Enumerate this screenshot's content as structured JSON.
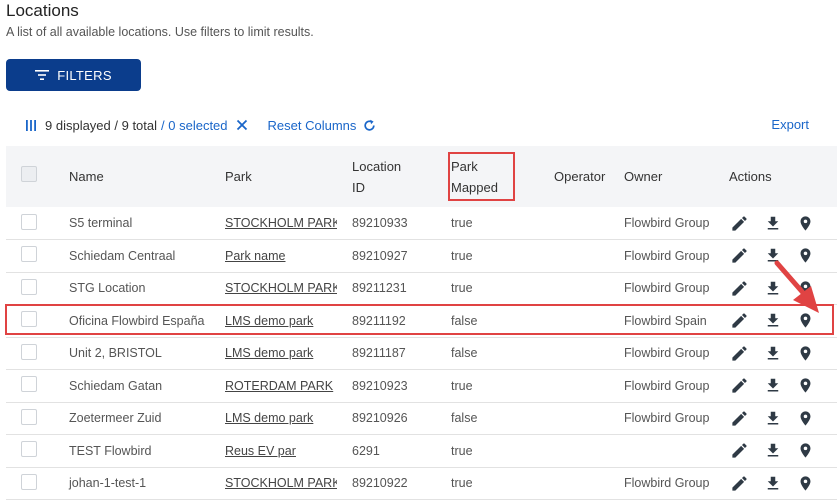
{
  "page": {
    "title": "Locations",
    "subtitle": "A list of all available locations. Use filters to limit results."
  },
  "filters_button": {
    "label": "FILTERS",
    "icon": "filter-icon"
  },
  "toolbar": {
    "columns_icon": "columns-icon",
    "displayed": "9 displayed / 9 total",
    "selected": "/ 0 selected",
    "clear_icon": "close-icon",
    "reset_columns": "Reset Columns",
    "reset_icon": "refresh-icon",
    "export": "Export"
  },
  "columns": {
    "name": "Name",
    "park": "Park",
    "location_id_1": "Location",
    "location_id_2": "ID",
    "park_mapped_1": "Park",
    "park_mapped_2": "Mapped",
    "operator": "Operator",
    "owner": "Owner",
    "actions": "Actions"
  },
  "rows": [
    {
      "name": "S5 terminal",
      "park": "STOCKHOLM PARK",
      "location_id": "89210933",
      "park_mapped": "true",
      "operator": "",
      "owner": "Flowbird Group",
      "icons": [
        "pencil-icon",
        "download-icon",
        "map-pin-icon"
      ]
    },
    {
      "name": "Schiedam Centraal",
      "park": "Park name",
      "location_id": "89210927",
      "park_mapped": "true",
      "operator": "",
      "owner": "Flowbird Group",
      "icons": [
        "pencil-icon",
        "download-icon",
        "map-pin-icon"
      ]
    },
    {
      "name": "STG Location",
      "park": "STOCKHOLM PARK",
      "location_id": "89211231",
      "park_mapped": "true",
      "operator": "",
      "owner": "Flowbird Group",
      "icons": [
        "pencil-icon",
        "download-icon",
        "map-pin-icon"
      ]
    },
    {
      "name": "Oficina Flowbird España",
      "park": "LMS demo park",
      "location_id": "89211192",
      "park_mapped": "false",
      "operator": "",
      "owner": "Flowbird Spain",
      "icons": [
        "pencil-icon",
        "download-icon",
        "map-pin-icon"
      ]
    },
    {
      "name": "Unit 2, BRISTOL",
      "park": "LMS demo park",
      "location_id": "89211187",
      "park_mapped": "false",
      "operator": "",
      "owner": "Flowbird Group",
      "icons": [
        "pencil-icon",
        "download-icon",
        "map-pin-icon"
      ]
    },
    {
      "name": "Schiedam Gatan",
      "park": "ROTERDAM PARK",
      "location_id": "89210923",
      "park_mapped": "true",
      "operator": "",
      "owner": "Flowbird Group",
      "icons": [
        "pencil-icon",
        "download-icon",
        "map-pin-icon"
      ]
    },
    {
      "name": "Zoetermeer Zuid",
      "park": "LMS demo park",
      "location_id": "89210926",
      "park_mapped": "false",
      "operator": "",
      "owner": "Flowbird Group",
      "icons": [
        "pencil-icon",
        "download-icon",
        "map-pin-icon"
      ]
    },
    {
      "name": "TEST Flowbird",
      "park": "Reus EV par",
      "location_id": "6291",
      "park_mapped": "true",
      "operator": "",
      "owner": "",
      "icons": [
        "pencil-icon",
        "download-icon",
        "map-pin-icon"
      ]
    },
    {
      "name": "johan-1-test-1",
      "park": "STOCKHOLM PARK",
      "location_id": "89210922",
      "park_mapped": "true",
      "operator": "",
      "owner": "Flowbird Group",
      "icons": [
        "pencil-icon",
        "download-icon",
        "map-pin-icon"
      ]
    }
  ],
  "colors": {
    "primary_button": "#0b3d8c",
    "link": "#1a66c9",
    "highlight": "#e04343",
    "header_bg": "#f4f5f7"
  }
}
